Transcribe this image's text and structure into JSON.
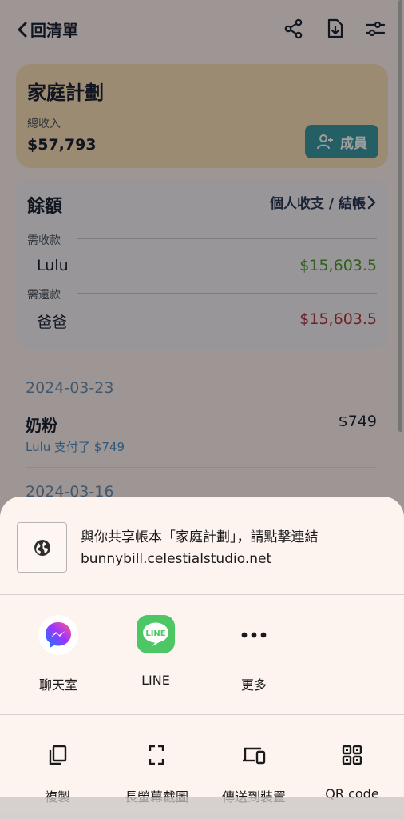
{
  "header": {
    "back_label": "回清單"
  },
  "plan": {
    "title": "家庭計劃",
    "income_label": "總收入",
    "income_value": "$57,793",
    "members_button": "成員"
  },
  "balance": {
    "title": "餘額",
    "link_label": "個人收支 / 結帳",
    "receivable_label": "需收款",
    "receivable": {
      "name": "Lulu",
      "amount": "$15,603.5"
    },
    "payable_label": "需還款",
    "payable": {
      "name": "爸爸",
      "amount": "$15,603.5"
    }
  },
  "transactions": [
    {
      "date": "2024-03-23",
      "title": "奶粉",
      "amount": "$749",
      "subtitle": "Lulu 支付了 $749"
    },
    {
      "date": "2024-03-16"
    }
  ],
  "share_sheet": {
    "title": "與你共享帳本「家庭計劃」，請點擊連結",
    "url": "bunnybill.celestialstudio.net",
    "apps": [
      {
        "label": "聊天室",
        "icon": "messenger-icon"
      },
      {
        "label": "LINE",
        "icon": "line-icon"
      },
      {
        "label": "更多",
        "icon": "more-dots-icon"
      }
    ],
    "actions": [
      {
        "label": "複製",
        "icon": "copy-icon"
      },
      {
        "label": "長螢幕截圖",
        "icon": "long-screenshot-icon"
      },
      {
        "label": "傳送到裝置",
        "icon": "send-to-device-icon"
      },
      {
        "label": "QR code",
        "icon": "qr-code-icon"
      }
    ]
  },
  "colors": {
    "plan_card": "#fbe0b9",
    "accent_teal": "#3a9aa3",
    "positive": "#4e9a2e",
    "negative": "#b6353c",
    "line_green": "#4cc764"
  }
}
